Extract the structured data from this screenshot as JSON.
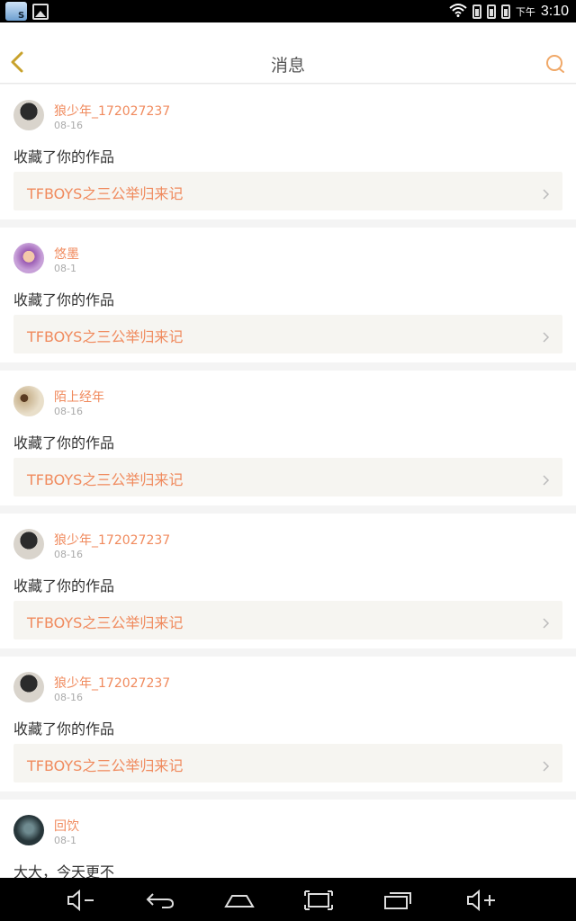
{
  "status_bar": {
    "time_label": "下午",
    "time": "3:10",
    "icons": [
      "app-icon",
      "gallery-icon",
      "wifi-icon",
      "sim1-icon",
      "sim2-icon",
      "battery-icon"
    ]
  },
  "header": {
    "title": "消息",
    "back_icon": "chevron-left-icon",
    "search_icon": "search-icon",
    "accent": "#f0a868"
  },
  "colors": {
    "accent": "#f08a5d",
    "card_bg": "#ffffff",
    "link_bg": "#f6f5f1",
    "divider": "#f4f4f4"
  },
  "messages": [
    {
      "username": "狼少年_172027237",
      "date": "08-16",
      "text": "收藏了你的作品",
      "work_title": "TFBOYS之三公举归来记"
    },
    {
      "username": "悠墨",
      "date": "08-1",
      "text": "收藏了你的作品",
      "work_title": "TFBOYS之三公举归来记"
    },
    {
      "username": "陌上经年",
      "date": "08-16",
      "text": "收藏了你的作品",
      "work_title": "TFBOYS之三公举归来记"
    },
    {
      "username": "狼少年_172027237",
      "date": "08-16",
      "text": "收藏了你的作品",
      "work_title": "TFBOYS之三公举归来记"
    },
    {
      "username": "狼少年_172027237",
      "date": "08-16",
      "text": "收藏了你的作品",
      "work_title": "TFBOYS之三公举归来记"
    },
    {
      "username": "回饮",
      "date": "08-1",
      "text": "大大，今天更不",
      "work_title": ""
    }
  ],
  "nav_bar": {
    "icons": [
      "volume-down-icon",
      "back-icon",
      "home-icon",
      "screenshot-icon",
      "recent-apps-icon",
      "volume-up-icon"
    ]
  }
}
